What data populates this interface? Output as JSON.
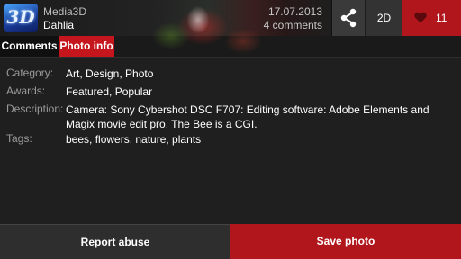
{
  "header": {
    "logo_text": "3D",
    "app_name": "Media3D",
    "photo_title": "Dahlia",
    "date": "17.07.2013",
    "comments_count": "4 comments",
    "share_icon": "share-icon",
    "mode_label": "2D",
    "like_icon": "heart-icon",
    "like_count": "11"
  },
  "tabs": [
    {
      "label": "Comments",
      "active": false
    },
    {
      "label": "Photo info",
      "active": true
    }
  ],
  "info": [
    {
      "label": "Category:",
      "value": "Art, Design, Photo"
    },
    {
      "label": "Awards:",
      "value": "Featured, Popular"
    },
    {
      "label": "Description:",
      "value": "Camera: Sony Cybershot DSC F707: Editing software: Adobe Elements and Magix movie edit pro. The Bee is a CGI."
    },
    {
      "label": "Tags:",
      "value": "bees, flowers, nature, plants"
    }
  ],
  "footer": {
    "report_label": "Report abuse",
    "save_label": "Save photo"
  },
  "colors": {
    "accent": "#b0161b",
    "background": "#1f1f1f"
  }
}
